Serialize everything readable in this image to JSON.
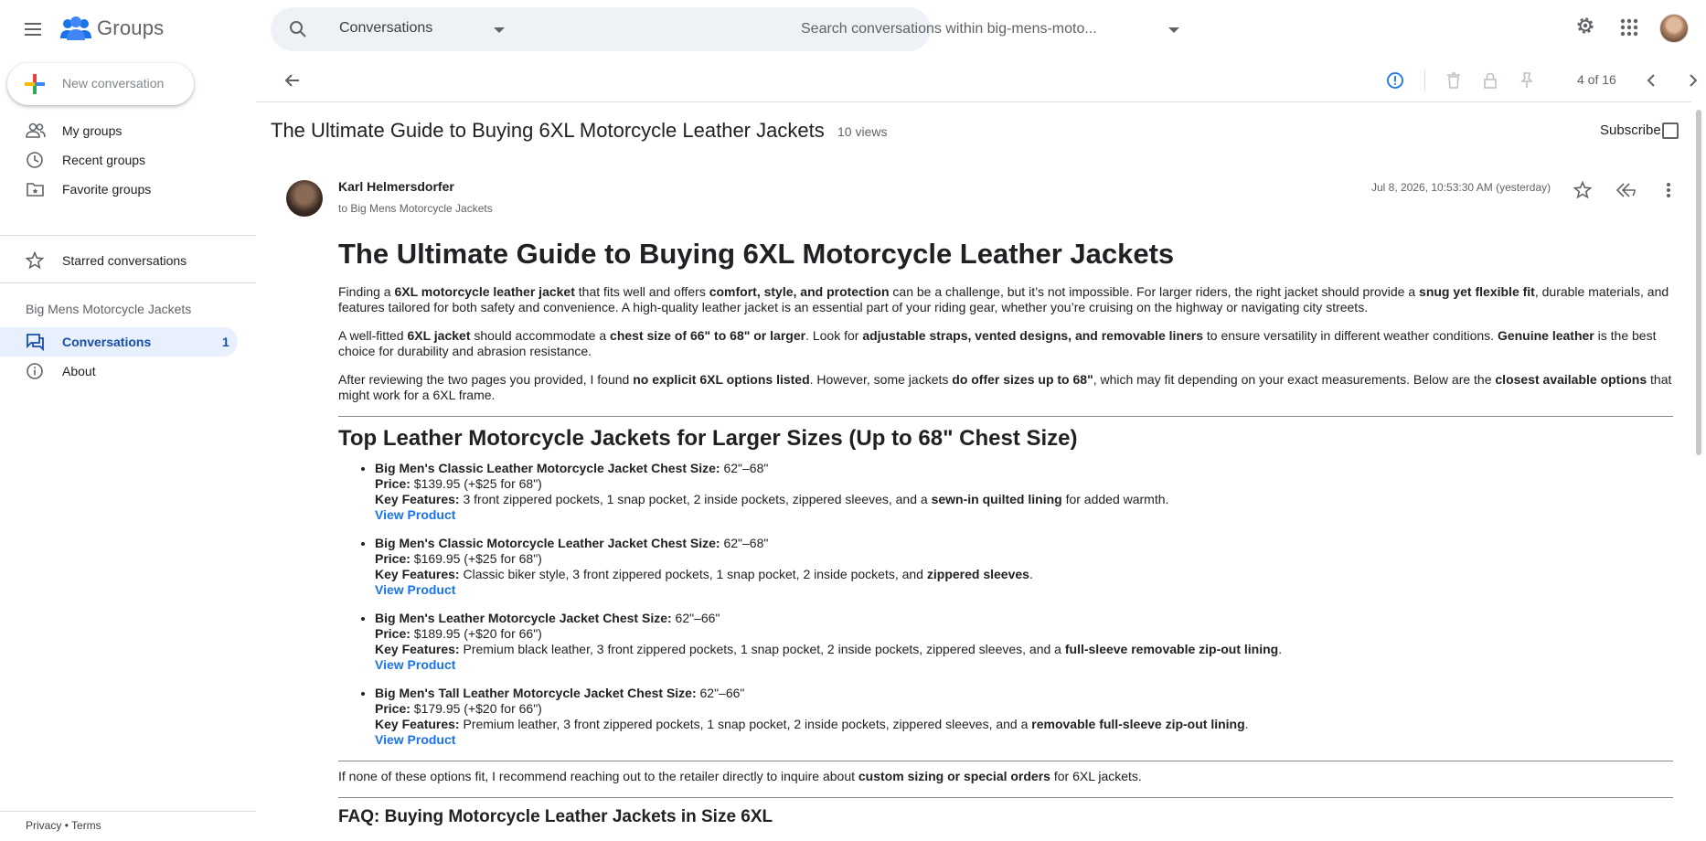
{
  "app": {
    "name": "Groups",
    "brand_colors": {
      "blue": "#1a73e8",
      "active_bg": "#e8f0fe",
      "active_text": "#174ea6"
    }
  },
  "search": {
    "scope": "Conversations",
    "placeholder": "Search conversations within big-mens-moto..."
  },
  "sidebar": {
    "new_conversation": "New conversation",
    "items": [
      {
        "label": "My groups",
        "icon": "people-icon"
      },
      {
        "label": "Recent groups",
        "icon": "clock-icon"
      },
      {
        "label": "Favorite groups",
        "icon": "folder-star-icon"
      }
    ],
    "starred": "Starred conversations",
    "group_name": "Big Mens Motorcycle Jackets",
    "group_items": [
      {
        "label": "Conversations",
        "count": "1",
        "active": true
      },
      {
        "label": "About"
      }
    ],
    "footer": {
      "privacy": "Privacy",
      "sep": "•",
      "terms": "Terms"
    }
  },
  "toolbar": {
    "pager": "4 of 16"
  },
  "thread": {
    "title": "The Ultimate Guide to Buying 6XL Motorcycle Leather Jackets",
    "views": "10 views",
    "subscribe": "Subscribe"
  },
  "message": {
    "author": "Karl Helmersdorfer",
    "to": "to Big Mens Motorcycle Jackets",
    "date": "Jul 8, 2026, 10:53:30 AM (yesterday)",
    "heading": "The Ultimate Guide to Buying 6XL Motorcycle Leather Jackets",
    "p1": [
      {
        "t": "Finding a "
      },
      {
        "t": "6XL motorcycle leather jacket",
        "b": true
      },
      {
        "t": " that fits well and offers "
      },
      {
        "t": "comfort, style, and protection",
        "b": true
      },
      {
        "t": " can be a challenge, but it’s not impossible. For larger riders, the right jacket should provide a "
      },
      {
        "t": "snug yet flexible fit",
        "b": true
      },
      {
        "t": ", durable materials, and features tailored for both safety and convenience. A high-quality leather jacket is an essential part of your riding gear, whether you’re cruising on the highway or navigating city streets."
      }
    ],
    "p2": [
      {
        "t": "A well-fitted "
      },
      {
        "t": "6XL jacket",
        "b": true
      },
      {
        "t": " should accommodate a "
      },
      {
        "t": "chest size of 66\" to 68\" or larger",
        "b": true
      },
      {
        "t": ". Look for "
      },
      {
        "t": "adjustable straps, vented designs, and removable liners",
        "b": true
      },
      {
        "t": " to ensure versatility in different weather conditions. "
      },
      {
        "t": "Genuine leather",
        "b": true
      },
      {
        "t": " is the best choice for durability and abrasion resistance."
      }
    ],
    "p3": [
      {
        "t": "After reviewing the two pages you provided, I found "
      },
      {
        "t": "no explicit 6XL options listed",
        "b": true
      },
      {
        "t": ". However, some jackets "
      },
      {
        "t": "do offer sizes up to 68\"",
        "b": true
      },
      {
        "t": ", which may fit depending on your exact measurements. Below are the "
      },
      {
        "t": "closest available options",
        "b": true
      },
      {
        "t": " that might work for a 6XL frame."
      }
    ],
    "section_heading": "Top Leather Motorcycle Jackets for Larger Sizes (Up to 68\" Chest Size)",
    "products": [
      {
        "name": "Big Men's Classic Leather Motorcycle Jacket Chest Size:",
        "size": " 62\"–68\"",
        "price_label": "Price:",
        "price": " $139.95 (+$25 for 68\")",
        "features_label": "Key Features:",
        "features": [
          {
            "t": " 3 front zippered pockets, 1 snap pocket, 2 inside pockets, zippered sleeves, and a "
          },
          {
            "t": "sewn-in quilted lining",
            "b": true
          },
          {
            "t": " for added warmth."
          }
        ],
        "link": "View Product"
      },
      {
        "name": "Big Men's Classic Motorcycle Leather Jacket Chest Size:",
        "size": " 62\"–68\"",
        "price_label": "Price:",
        "price": " $169.95 (+$25 for 68\")",
        "features_label": "Key Features:",
        "features": [
          {
            "t": " Classic biker style, 3 front zippered pockets, 1 snap pocket, 2 inside pockets, and "
          },
          {
            "t": "zippered sleeves",
            "b": true
          },
          {
            "t": "."
          }
        ],
        "link": "View Product"
      },
      {
        "name": "Big Men's Leather Motorcycle Jacket Chest Size:",
        "size": " 62\"–66\"",
        "price_label": "Price:",
        "price": " $189.95 (+$20 for 66\")",
        "features_label": "Key Features:",
        "features": [
          {
            "t": " Premium black leather, 3 front zippered pockets, 1 snap pocket, 2 inside pockets, zippered sleeves, and a "
          },
          {
            "t": "full-sleeve removable zip-out lining",
            "b": true
          },
          {
            "t": "."
          }
        ],
        "link": "View Product"
      },
      {
        "name": "Big Men's Tall Leather Motorcycle Jacket Chest Size:",
        "size": " 62\"–66\"",
        "price_label": "Price:",
        "price": " $179.95 (+$20 for 66\")",
        "features_label": "Key Features:",
        "features": [
          {
            "t": " Premium leather, 3 front zippered pockets, 1 snap pocket, 2 inside pockets, zippered sleeves, and a "
          },
          {
            "t": "removable full-sleeve zip-out lining",
            "b": true
          },
          {
            "t": "."
          }
        ],
        "link": "View Product"
      }
    ],
    "p4": [
      {
        "t": "If none of these options fit, I recommend reaching out to the retailer directly to inquire about "
      },
      {
        "t": "custom sizing or special orders",
        "b": true
      },
      {
        "t": " for 6XL jackets."
      }
    ],
    "faq_heading": "FAQ: Buying Motorcycle Leather Jackets in Size 6XL"
  }
}
